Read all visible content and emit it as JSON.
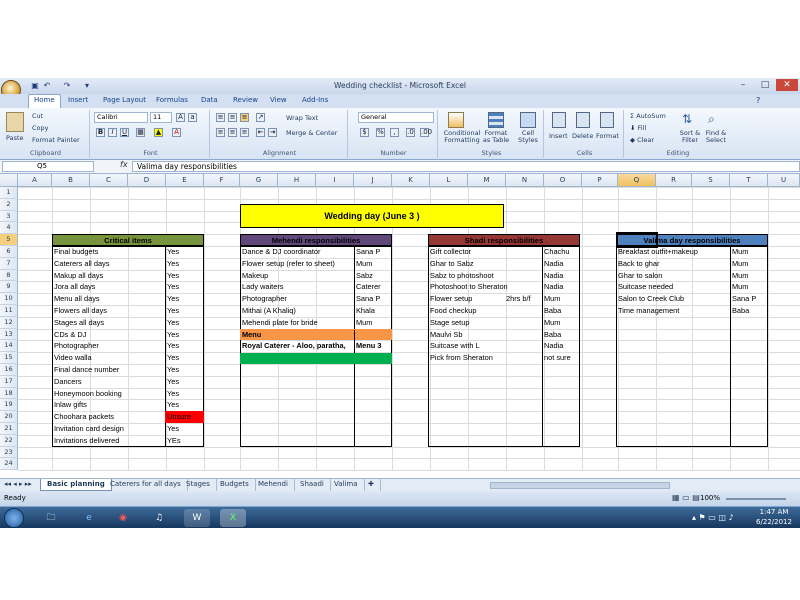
{
  "window": {
    "title": "Wedding checklist - Microsoft Excel"
  },
  "ribbon": {
    "tabs": [
      "Home",
      "Insert",
      "Page Layout",
      "Formulas",
      "Data",
      "Review",
      "View",
      "Add-Ins"
    ],
    "clipboard": {
      "paste": "Paste",
      "cut": "Cut",
      "copy": "Copy",
      "format_painter": "Format Painter",
      "label": "Clipboard"
    },
    "font": {
      "name": "Calibri",
      "size": "11",
      "label": "Font"
    },
    "alignment": {
      "wrap": "Wrap Text",
      "merge": "Merge & Center",
      "label": "Alignment"
    },
    "number": {
      "format": "General",
      "label": "Number"
    },
    "styles": {
      "conditional": "Conditional Formatting",
      "table": "Format as Table",
      "cell": "Cell Styles",
      "label": "Styles"
    },
    "cells": {
      "insert": "Insert",
      "delete": "Delete",
      "format": "Format",
      "label": "Cells"
    },
    "editing": {
      "autosum": "AutoSum",
      "fill": "Fill",
      "clear": "Clear",
      "sort": "Sort & Filter",
      "find": "Find & Select",
      "label": "Editing"
    }
  },
  "formula_bar": {
    "name_box": "Q5",
    "fx": "fx",
    "content": "Valima day responsibilities"
  },
  "columns": [
    "A",
    "B",
    "C",
    "D",
    "E",
    "F",
    "G",
    "H",
    "I",
    "J",
    "K",
    "L",
    "M",
    "N",
    "O",
    "P",
    "Q",
    "R",
    "S",
    "T",
    "U"
  ],
  "rows": [
    "1",
    "2",
    "3",
    "4",
    "5",
    "6",
    "7",
    "8",
    "9",
    "10",
    "11",
    "12",
    "13",
    "14",
    "15",
    "16",
    "17",
    "18",
    "19",
    "20",
    "21",
    "22",
    "23",
    "24"
  ],
  "sheet": {
    "banner": "Wedding day (June 3 )",
    "critical": {
      "header": "Critical items",
      "items": [
        [
          "Final budgets",
          "Yes"
        ],
        [
          "Caterers all days",
          "Yes"
        ],
        [
          "Makup all days",
          "Yes"
        ],
        [
          "Jora all days",
          "Yes"
        ],
        [
          "Menu all days",
          "Yes"
        ],
        [
          "Flowers all days",
          "Yes"
        ],
        [
          "Stages all days",
          "Yes"
        ],
        [
          "CDs & DJ",
          "Yes"
        ],
        [
          "Photographer",
          "Yes"
        ],
        [
          "Video walla",
          "Yes"
        ],
        [
          "Final dance number",
          "Yes"
        ],
        [
          "Dancers",
          "Yes"
        ],
        [
          "Honeymoon booking",
          "Yes"
        ],
        [
          "Inlaw gifts",
          "Yes"
        ],
        [
          "Choohara packets",
          "Unsure"
        ],
        [
          "Invitation card design",
          "Yes"
        ],
        [
          "Invitations delivered",
          "YEs"
        ]
      ]
    },
    "mehendi": {
      "header": "Mehendi responsibilities",
      "items": [
        [
          "Dance  & DJ coordinator",
          "Sana P"
        ],
        [
          "Flower setup (refer to sheet)",
          "Mum"
        ],
        [
          "Makeup",
          "Sabz"
        ],
        [
          "Lady waiters",
          "Caterer"
        ],
        [
          "Photographer",
          "Sana P"
        ],
        [
          "Mithai (A Khaliq)",
          "Khala"
        ],
        [
          "Mehendi plate for bride",
          "Mum"
        ]
      ],
      "menu_label": "Menu",
      "menu_item": "Royal Caterer - Aloo, paratha, ",
      "menu_ref": "Menu 3"
    },
    "shadi": {
      "header": "Shadi responsibilities",
      "items": [
        [
          "Gift collector",
          "",
          "Chachu"
        ],
        [
          "Ghar to Sabz",
          "",
          "Nadia"
        ],
        [
          "Sabz to photoshoot",
          "",
          "Nadia"
        ],
        [
          "Photoshoot to Sheraton",
          "",
          "Nadia"
        ],
        [
          "Flower setup",
          "2hrs b/f",
          "Mum"
        ],
        [
          "Food checkup",
          "",
          "Baba"
        ],
        [
          "Stage setup",
          "",
          "Mum"
        ],
        [
          "Maulvi Sb",
          "",
          "Baba"
        ],
        [
          "Suitcase with L",
          "",
          "Nadia"
        ],
        [
          "Pick from Sheraton",
          "",
          "not sure"
        ]
      ]
    },
    "valima": {
      "header": "Valima day responsibilities",
      "items": [
        [
          "Breakfast outfit+makeup",
          "Mum"
        ],
        [
          "Back to ghar",
          "Mum"
        ],
        [
          "Ghar to salon",
          "Mum"
        ],
        [
          "Suitcase needed",
          "Mum"
        ],
        [
          "Salon to Creek Club",
          "Sana P"
        ],
        [
          "Time management",
          "Baba"
        ]
      ]
    }
  },
  "sheet_tabs": [
    "Basic planning",
    "Caterers for all days",
    "Stages",
    "Budgets",
    "Mehendi",
    "Shaadi",
    "Valima"
  ],
  "status": {
    "ready": "Ready",
    "zoom": "100%"
  },
  "taskbar": {
    "time": "1:47 AM",
    "date": "6/22/2012"
  },
  "colors": {
    "green_header": "#77933c",
    "purple_header": "#60497a",
    "red_header": "#953735",
    "blue_header": "#4f81bd",
    "banner": "#ffff00",
    "unsure": "#ff0000",
    "menu_orange": "#f79646",
    "green_bar": "#00b050"
  }
}
